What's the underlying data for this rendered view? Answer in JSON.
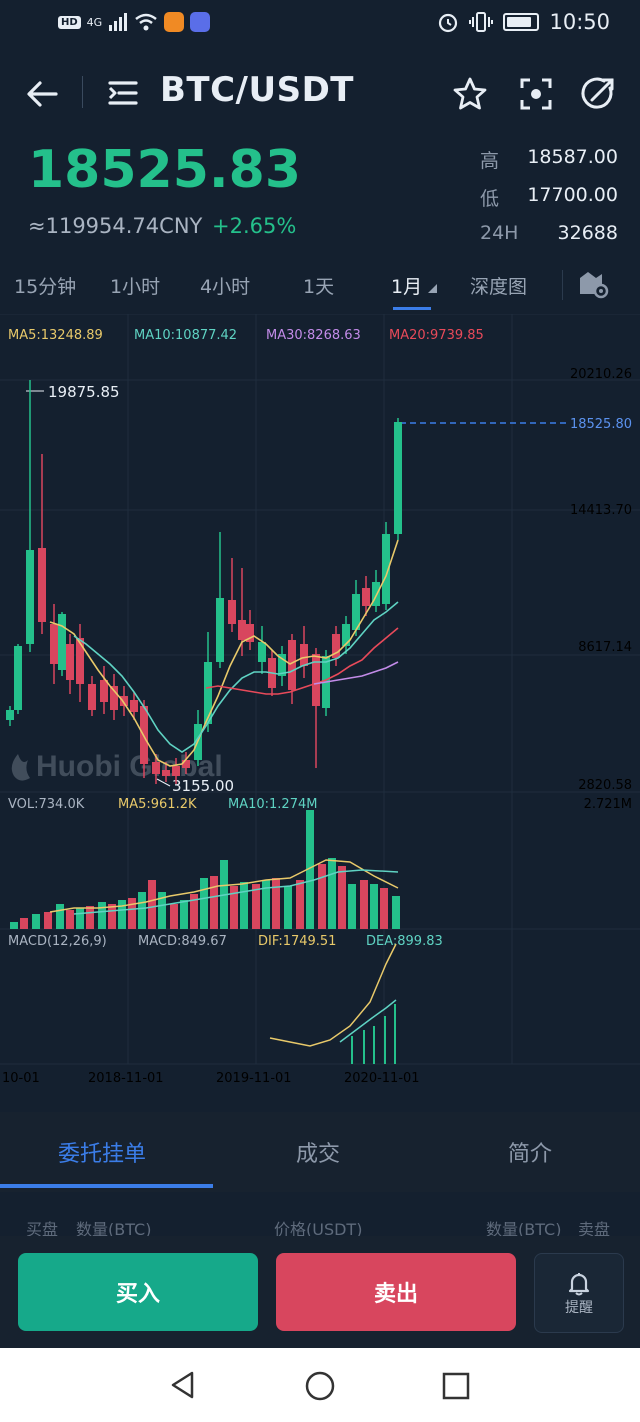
{
  "status_bar": {
    "hd": "HD",
    "network": "4G",
    "time": "10:50"
  },
  "header": {
    "title": "BTC/USDT"
  },
  "price": {
    "last": "18525.83",
    "cny": "≈119954.74CNY",
    "change": "+2.65%",
    "high_label": "高",
    "high": "18587.00",
    "low_label": "低",
    "low": "17700.00",
    "vol_label": "24H",
    "vol": "32688"
  },
  "intervals": [
    "15分钟",
    "1小时",
    "4小时",
    "1天",
    "1月",
    "深度图"
  ],
  "chart": {
    "ma": {
      "ma5": "MA5:13248.89",
      "ma10": "MA10:10877.42",
      "ma30": "MA30:8268.63",
      "ma20": "MA20:9739.85"
    },
    "y_labels": [
      "20210.26",
      "18525.80",
      "14413.70",
      "8617.14",
      "2820.58"
    ],
    "max_label": "19875.85",
    "min_label": "3155.00",
    "watermark": "Huobi Global",
    "vol": {
      "vol": "VOL:734.0K",
      "ma5": "MA5:961.2K",
      "ma10": "MA10:1.274M",
      "max": "2.721M"
    },
    "macd": {
      "title": "MACD(12,26,9)",
      "macd": "MACD:849.67",
      "dif": "DIF:1749.51",
      "dea": "DEA:899.83"
    },
    "x_labels": [
      "10-01",
      "2018-11-01",
      "2019-11-01",
      "2020-11-01"
    ]
  },
  "order_tabs": [
    "委托挂单",
    "成交",
    "简介"
  ],
  "order_book_header": {
    "buy": "买盘",
    "qty_left": "数量(BTC)",
    "price": "价格(USDT)",
    "qty_right": "数量(BTC)",
    "sell": "卖盘"
  },
  "actions": {
    "buy": "买入",
    "sell": "卖出",
    "alert": "提醒"
  },
  "colors": {
    "up": "#24c08b",
    "down": "#d8465e",
    "accent": "#3b7de8",
    "background": "#14202f"
  }
}
